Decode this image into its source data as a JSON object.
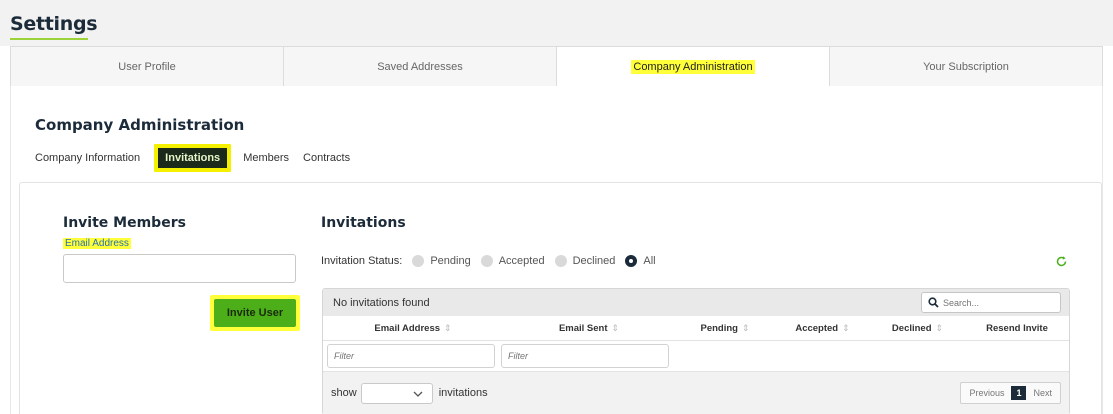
{
  "header": {
    "title": "Settings"
  },
  "tabs": [
    {
      "label": "User Profile"
    },
    {
      "label": "Saved Addresses"
    },
    {
      "label": "Company Administration"
    },
    {
      "label": "Your Subscription"
    }
  ],
  "company_admin": {
    "title": "Company Administration",
    "subtabs": [
      {
        "label": "Company Information"
      },
      {
        "label": "Invitations"
      },
      {
        "label": "Members"
      },
      {
        "label": "Contracts"
      }
    ]
  },
  "invite_members": {
    "title": "Invite Members",
    "email_label": "Email Address",
    "email_value": "",
    "button_label": "Invite User"
  },
  "invitations": {
    "title": "Invitations",
    "status_label": "Invitation Status:",
    "status_options": [
      {
        "label": "Pending",
        "checked": false
      },
      {
        "label": "Accepted",
        "checked": false
      },
      {
        "label": "Declined",
        "checked": false
      },
      {
        "label": "All",
        "checked": true
      }
    ],
    "grid": {
      "empty_message": "No invitations found",
      "search_placeholder": "Search...",
      "columns": [
        "Email Address",
        "Email Sent",
        "Pending",
        "Accepted",
        "Declined",
        "Resend Invite"
      ],
      "sort_glyph": "⇕",
      "filter_placeholder": "Filter",
      "footer": {
        "show_label": "show",
        "page_size_value": "",
        "suffix_label": "invitations",
        "previous_label": "Previous",
        "current_page": "1",
        "next_label": "Next"
      }
    }
  },
  "colors": {
    "accent_green": "#4caf1a",
    "highlight_yellow": "#ffff3a",
    "navy": "#1c2b39"
  },
  "icons": {
    "search": "search-icon",
    "refresh": "refresh-icon",
    "dropdown": "chevron-down-icon"
  }
}
